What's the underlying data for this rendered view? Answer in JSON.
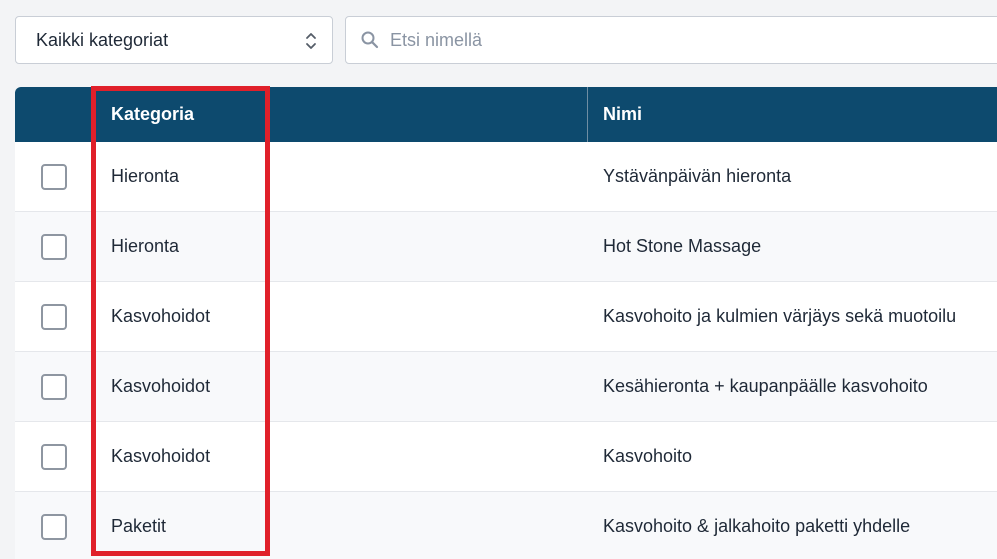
{
  "filters": {
    "category_select": {
      "selected": "Kaikki kategoriat",
      "icon": "chevron-up-down-icon"
    },
    "search": {
      "placeholder": "Etsi nimellä",
      "value": "",
      "icon": "search-icon"
    }
  },
  "table": {
    "columns": {
      "category": "Kategoria",
      "name": "Nimi"
    },
    "rows": [
      {
        "category": "Hieronta",
        "name": "Ystävänpäivän hieronta"
      },
      {
        "category": "Hieronta",
        "name": "Hot Stone Massage"
      },
      {
        "category": "Kasvohoidot",
        "name": "Kasvohoito ja kulmien värjäys sekä muotoilu"
      },
      {
        "category": "Kasvohoidot",
        "name": "Kesähieronta + kaupanpäälle kasvohoito"
      },
      {
        "category": "Kasvohoidot",
        "name": "Kasvohoito"
      },
      {
        "category": "Paketit",
        "name": "Kasvohoito & jalkahoito paketti yhdelle"
      }
    ]
  },
  "colors": {
    "header_bg": "#0d4a6e",
    "highlight": "#e0202a"
  }
}
